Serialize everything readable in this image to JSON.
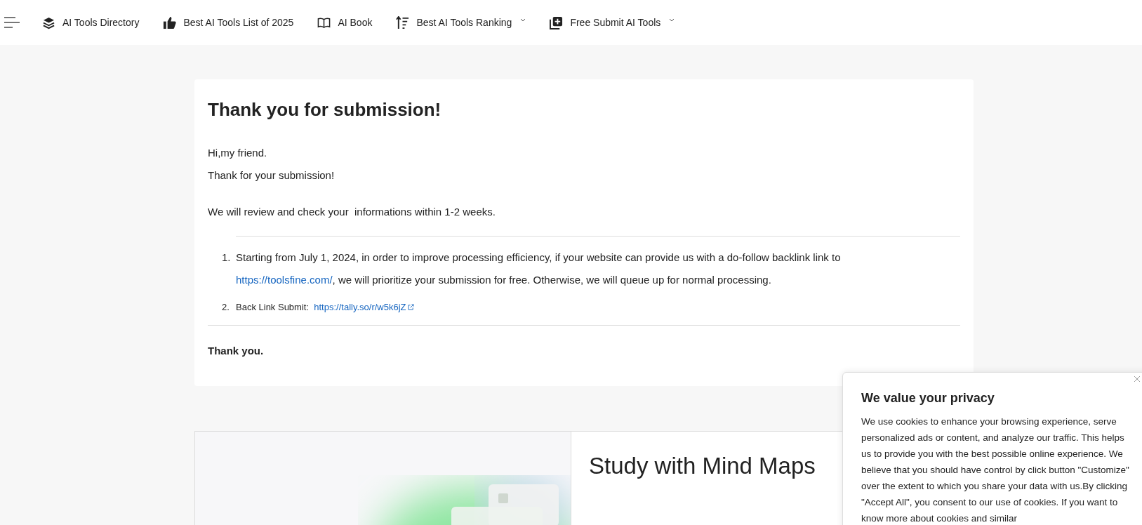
{
  "nav": {
    "items": [
      {
        "label": "AI Tools Directory",
        "dropdown": false
      },
      {
        "label": "Best AI Tools List of 2025",
        "dropdown": false
      },
      {
        "label": "AI Book",
        "dropdown": false
      },
      {
        "label": "Best AI Tools Ranking",
        "dropdown": true
      },
      {
        "label": "Free Submit AI Tools",
        "dropdown": true
      }
    ]
  },
  "card": {
    "title": "Thank you for submission!",
    "greeting": "Hi,my friend.",
    "thanks": "Thank for your submission!",
    "review": "We will review and check your  informations within 1-2 weeks.",
    "list": [
      {
        "kind": "text",
        "marker": "1.",
        "before": "Starting from July 1, 2024, in order to improve processing efficiency, if your website can provide us with a do-follow backlink link to",
        "link": "https://toolsfine.com/",
        "after": ", we will prioritize your submission for free. Otherwise, we will queue up for normal processing."
      },
      {
        "kind": "small",
        "marker": "2.",
        "before": "Back Link Submit:",
        "link": "https://tally.so/r/w5k6jZ"
      }
    ],
    "closing": "Thank you."
  },
  "promo": {
    "title": "Study with Mind Maps"
  },
  "cookie": {
    "title": "We value your privacy",
    "text": "We use cookies to enhance your browsing experience, serve personalized ads or content, and analyze our traffic. This helps us to provide you with the best possible online experience. We believe that you should have control by click button \"Customize\" over the extent to which you share your data with us.By clicking \"Accept All\", you consent to our use of cookies. If you want to know more about cookies and similar"
  }
}
